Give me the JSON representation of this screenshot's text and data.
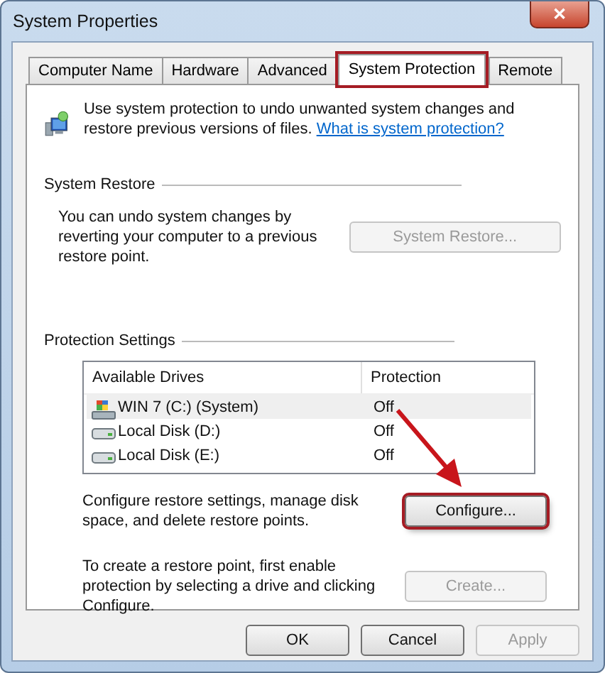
{
  "window": {
    "title": "System Properties",
    "close": "✕"
  },
  "tabs": [
    {
      "label": "Computer Name",
      "selected": false,
      "highlighted": false
    },
    {
      "label": "Hardware",
      "selected": false,
      "highlighted": false
    },
    {
      "label": "Advanced",
      "selected": false,
      "highlighted": false
    },
    {
      "label": "System Protection",
      "selected": true,
      "highlighted": true
    },
    {
      "label": "Remote",
      "selected": false,
      "highlighted": false
    }
  ],
  "intro": {
    "text": "Use system protection to undo unwanted system changes and restore previous versions of files.",
    "link": "What is system protection?"
  },
  "system_restore": {
    "heading": "System Restore",
    "text": "You can undo system changes by reverting your computer to a previous restore point.",
    "button": {
      "label": "System Restore...",
      "disabled": true,
      "highlighted": false
    }
  },
  "protection_settings": {
    "heading": "Protection Settings",
    "columns": [
      "Available Drives",
      "Protection"
    ],
    "rows": [
      {
        "drive": "WIN 7 (C:) (System)",
        "kind": "system",
        "protection": "Off",
        "selected": true
      },
      {
        "drive": "Local Disk (D:)",
        "kind": "disk",
        "protection": "Off",
        "selected": false
      },
      {
        "drive": "Local Disk (E:)",
        "kind": "disk",
        "protection": "Off",
        "selected": false
      }
    ],
    "configure_text": "Configure restore settings, manage disk space, and delete restore points.",
    "configure_button": {
      "label": "Configure...",
      "disabled": false,
      "highlighted": true
    },
    "create_text": "To create a restore point, first enable protection by selecting a drive and clicking Configure.",
    "create_button": {
      "label": "Create...",
      "disabled": true,
      "highlighted": false
    }
  },
  "pointer_arrow": true,
  "buttons": [
    {
      "label": "OK",
      "disabled": false
    },
    {
      "label": "Cancel",
      "disabled": false
    },
    {
      "label": "Apply",
      "disabled": true
    }
  ]
}
